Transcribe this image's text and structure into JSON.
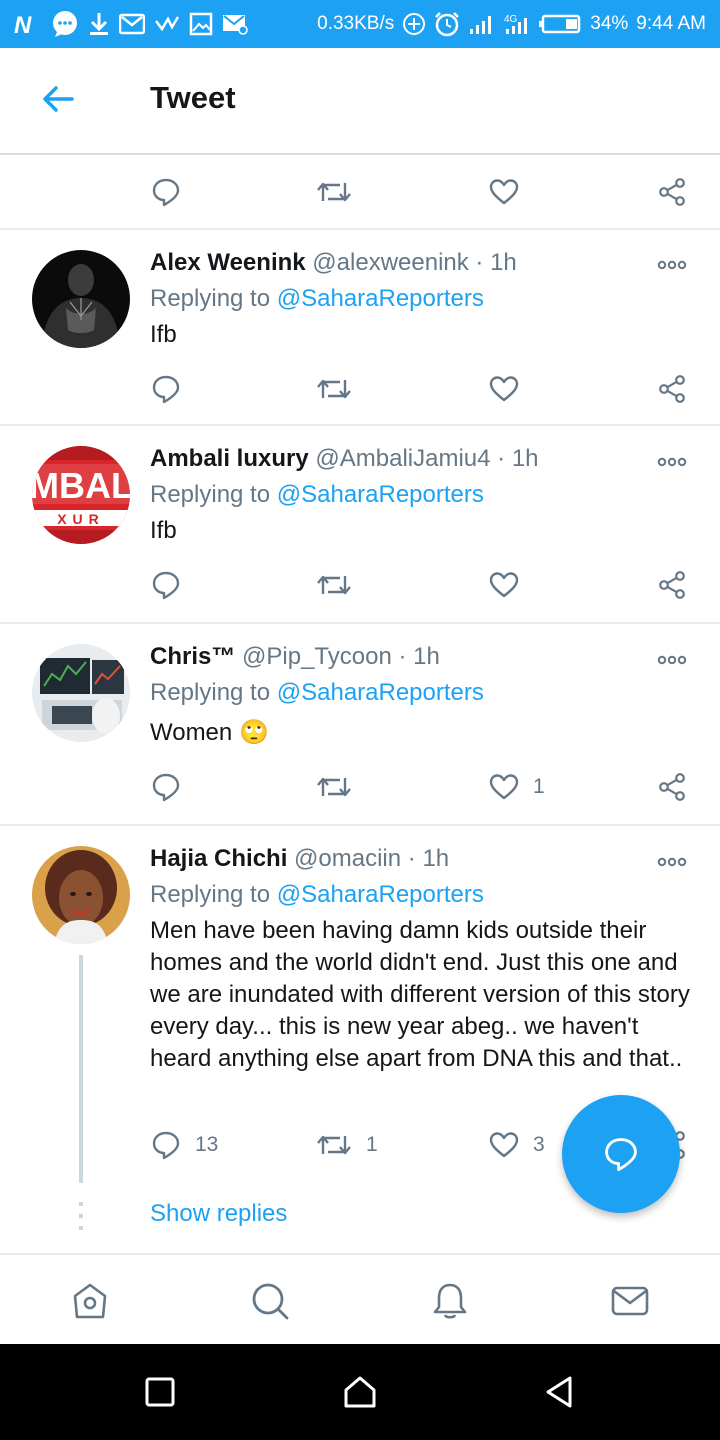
{
  "status_bar": {
    "speed": "0.33KB/s",
    "battery": "34%",
    "time": "9:44 AM",
    "icons": [
      "notification-n-icon",
      "chat-bubble-icon",
      "download-icon",
      "gmail-icon",
      "check-icon",
      "gallery-icon",
      "mail-off-icon",
      "add-circle-icon",
      "alarm-icon",
      "signal-icon",
      "signal-4g-icon",
      "battery-icon"
    ]
  },
  "header": {
    "title": "Tweet",
    "back_icon": "arrow-left-icon"
  },
  "top_actions": {
    "reply_count": "",
    "retweet_count": "",
    "like_count": ""
  },
  "tweets": [
    {
      "name": "Alex Weenink",
      "handle": "@alexweenink",
      "time": "· 1h",
      "replying_prefix": "Replying to",
      "replying_handle": "@SaharaReporters",
      "text": "Ifb",
      "reply_count": "",
      "retweet_count": "",
      "like_count": ""
    },
    {
      "name": "Ambali luxury",
      "handle": "@AmbaliJamiu4",
      "time": "· 1h",
      "replying_prefix": "Replying to",
      "replying_handle": "@SaharaReporters",
      "text": "Ifb",
      "avatar_text": "MBAL",
      "avatar_subtext": "XUR",
      "reply_count": "",
      "retweet_count": "",
      "like_count": ""
    },
    {
      "name": "Chris™",
      "handle": "@Pip_Tycoon",
      "time": "· 1h",
      "replying_prefix": "Replying to",
      "replying_handle": "@SaharaReporters",
      "text": "Women",
      "emoji": "🙄",
      "reply_count": "",
      "retweet_count": "",
      "like_count": "1"
    },
    {
      "name": "Hajia Chichi",
      "handle": "@omaciin",
      "time": "· 1h",
      "replying_prefix": "Replying to",
      "replying_handle": "@SaharaReporters",
      "text": "Men have been having damn kids outside their homes and the world didn't end. Just this one and we are inundated with different version of this story every day... this is new year abeg.. we haven't heard anything else apart from DNA this and that..",
      "reply_count": "13",
      "retweet_count": "1",
      "like_count": "3"
    }
  ],
  "show_replies": "Show replies",
  "colors": {
    "accent": "#1da1f2",
    "muted": "#657786",
    "text": "#14171a",
    "divider": "#e6ecf0"
  },
  "bottom_nav": [
    "home-icon",
    "search-icon",
    "notifications-bell-icon",
    "messages-envelope-icon"
  ],
  "android_nav": [
    "recents-square-icon",
    "home-outline-icon",
    "back-triangle-icon"
  ]
}
